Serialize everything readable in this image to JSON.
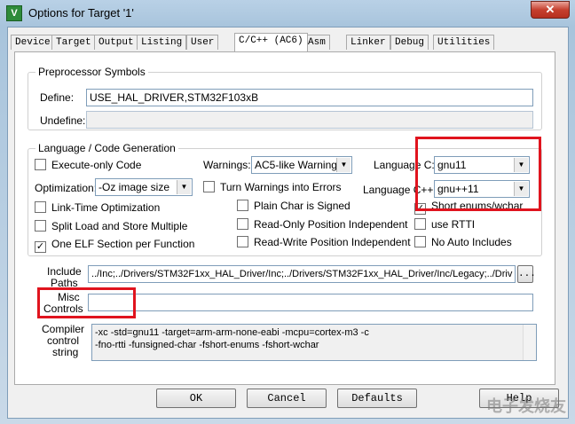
{
  "window": {
    "title": "Options for Target '1'",
    "icon": "keil-uv-icon",
    "close": "✕"
  },
  "tabs": [
    "Device",
    "Target",
    "Output",
    "Listing",
    "User",
    "C/C++ (AC6)",
    "Asm",
    "Linker",
    "Debug",
    "Utilities"
  ],
  "active_tab": "C/C++ (AC6)",
  "preprocessor": {
    "title": "Preprocessor Symbols",
    "define_label": "Define:",
    "define_value": "USE_HAL_DRIVER,STM32F103xB",
    "undefine_label": "Undefine:",
    "undefine_value": ""
  },
  "language": {
    "title": "Language / Code Generation",
    "execute_only": {
      "label": "Execute-only Code",
      "checked": false
    },
    "warnings_label": "Warnings:",
    "warnings_value": "AC5-like Warnings",
    "language_c_label": "Language C:",
    "language_c_value": "gnu11",
    "optimization_label": "Optimization:",
    "optimization_value": "-Oz image size",
    "turn_warnings": {
      "label": "Turn Warnings into Errors",
      "checked": false
    },
    "language_cpp_label": "Language C++:",
    "language_cpp_value": "gnu++11",
    "lto": {
      "label": "Link-Time Optimization",
      "checked": false
    },
    "plain_char": {
      "label": "Plain Char is Signed",
      "checked": false
    },
    "short_enums": {
      "label": "Short enums/wchar",
      "checked": true
    },
    "split_load": {
      "label": "Split Load and Store Multiple",
      "checked": false
    },
    "ro_pi": {
      "label": "Read-Only Position Independent",
      "checked": false
    },
    "use_rtti": {
      "label": "use RTTI",
      "checked": false
    },
    "one_elf": {
      "label": "One ELF Section per Function",
      "checked": true
    },
    "rw_pi": {
      "label": "Read-Write Position Independent",
      "checked": false
    },
    "no_auto_includes": {
      "label": "No Auto Includes",
      "checked": false
    }
  },
  "include": {
    "label_1": "Include",
    "label_2": "Paths",
    "value": "../Inc;../Drivers/STM32F1xx_HAL_Driver/Inc;../Drivers/STM32F1xx_HAL_Driver/Inc/Legacy;../Driv",
    "browse": "..."
  },
  "misc": {
    "label_1": "Misc",
    "label_2": "Controls",
    "value": ""
  },
  "compiler": {
    "label_1": "Compiler",
    "label_2": "control",
    "label_3": "string",
    "line_1": "-xc -std=gnu11 -target=arm-arm-none-eabi -mcpu=cortex-m3 -c",
    "line_2": "-fno-rtti -funsigned-char -fshort-enums -fshort-wchar"
  },
  "buttons": {
    "ok": "OK",
    "cancel": "Cancel",
    "defaults": "Defaults",
    "help": "Help"
  },
  "watermark": "电子发烧友",
  "colors": {
    "highlight": "#e0141e",
    "check": "#000000"
  }
}
